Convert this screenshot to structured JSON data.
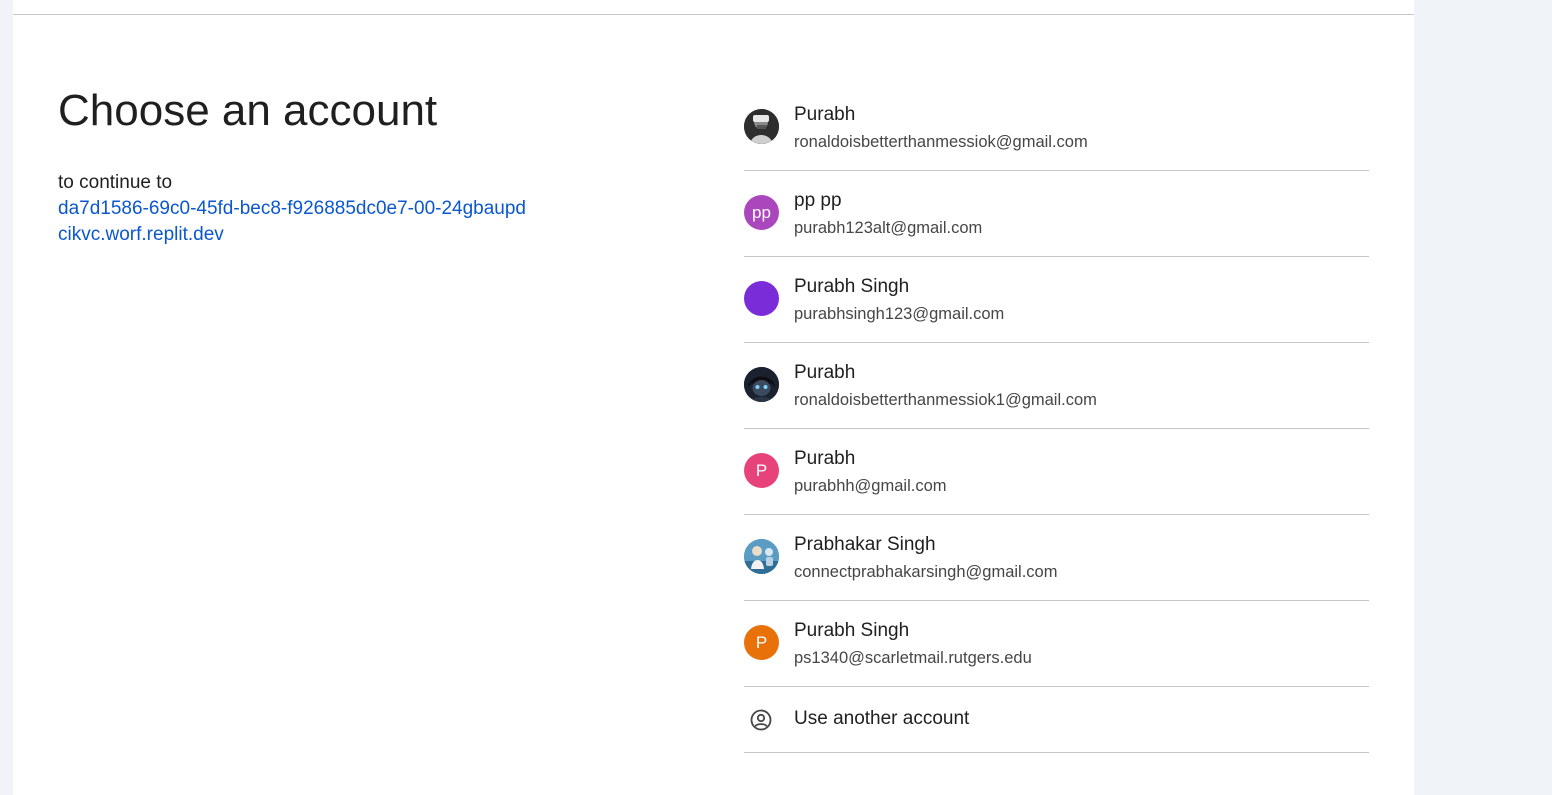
{
  "page": {
    "title": "Choose an account",
    "continue_label": "to continue to",
    "continue_target": "da7d1586-69c0-45fd-bec8-f926885dc0e7-00-24gbaupdcikvc.worf.replit.dev"
  },
  "accounts": [
    {
      "name": "Purabh",
      "email": "ronaldoisbetterthanmessiok@gmail.com",
      "avatar": "photo",
      "avatar_color": "#3a3a3a"
    },
    {
      "name": "pp pp",
      "email": "purabh123alt@gmail.com",
      "avatar": "initials",
      "initials": "pp",
      "avatar_color": "#ab47bc"
    },
    {
      "name": "Purabh Singh",
      "email": "purabhsingh123@gmail.com",
      "avatar": "solid",
      "avatar_color": "#7b2cd9"
    },
    {
      "name": "Purabh",
      "email": "ronaldoisbetterthanmessiok1@gmail.com",
      "avatar": "photo",
      "avatar_color": "#1c2a3a"
    },
    {
      "name": "Purabh",
      "email": "purabhh@gmail.com",
      "avatar": "initials",
      "initials": "P",
      "avatar_color": "#e8427a"
    },
    {
      "name": "Prabhakar Singh",
      "email": "connectprabhakarsingh@gmail.com",
      "avatar": "photo",
      "avatar_color": "#4a8bb5"
    },
    {
      "name": "Purabh Singh",
      "email": "ps1340@scarletmail.rutgers.edu",
      "avatar": "initials",
      "initials": "P",
      "avatar_color": "#e8710a"
    }
  ],
  "use_another": {
    "label": "Use another account",
    "icon": "account-circle-icon"
  }
}
